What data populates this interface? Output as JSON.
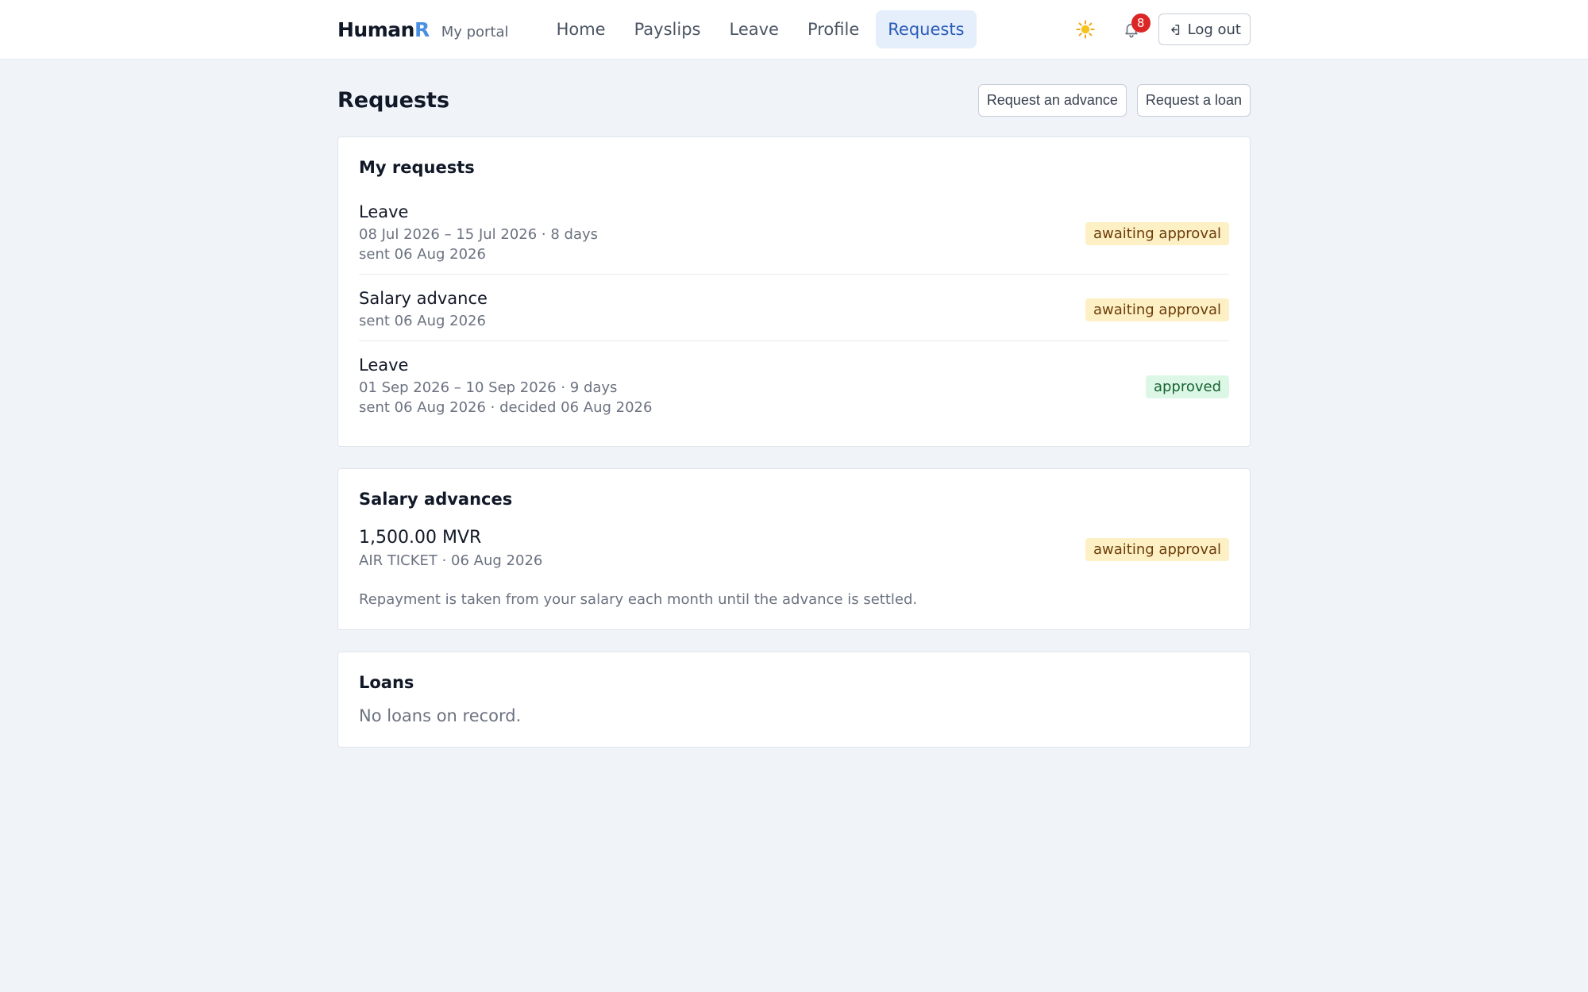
{
  "brand": {
    "name_main": "Human",
    "name_accent": "R",
    "subtitle": "My portal"
  },
  "nav": [
    {
      "label": "Home",
      "active": false
    },
    {
      "label": "Payslips",
      "active": false
    },
    {
      "label": "Leave",
      "active": false
    },
    {
      "label": "Profile",
      "active": false
    },
    {
      "label": "Requests",
      "active": true
    }
  ],
  "header": {
    "theme_icon": "sun-icon",
    "notifications_icon": "bell-icon",
    "notification_count": "8",
    "logout_label": "Log out",
    "logout_icon": "logout-icon"
  },
  "page": {
    "title": "Requests",
    "actions": {
      "advance_label": "Request an advance",
      "loan_label": "Request a loan"
    }
  },
  "my_requests": {
    "title": "My requests",
    "items": [
      {
        "type": "Leave",
        "dates": "08 Jul 2026 – 15 Jul 2026 · 8 days",
        "meta": "sent 06 Aug 2026",
        "status": "awaiting approval"
      },
      {
        "type": "Salary advance",
        "dates": "",
        "meta": "sent 06 Aug 2026",
        "status": "awaiting approval"
      },
      {
        "type": "Leave",
        "dates": "01 Sep 2026 – 10 Sep 2026 · 9 days",
        "meta": "sent 06 Aug 2026 · decided 06 Aug 2026",
        "status": "approved"
      }
    ]
  },
  "salary_advances": {
    "title": "Salary advances",
    "items": [
      {
        "amount": "1,500.00 MVR",
        "meta": "AIR TICKET · 06 Aug 2026",
        "status": "awaiting approval"
      }
    ],
    "note": "Repayment is taken from your salary each month until the advance is settled."
  },
  "loans": {
    "title": "Loans",
    "empty": "No loans on record."
  },
  "colors": {
    "accent": "#4a90e2",
    "active_nav_bg": "#e5eefb",
    "pending_bg": "#fdf0c4",
    "approved_bg": "#ddf7e6",
    "badge": "#dc2626"
  }
}
